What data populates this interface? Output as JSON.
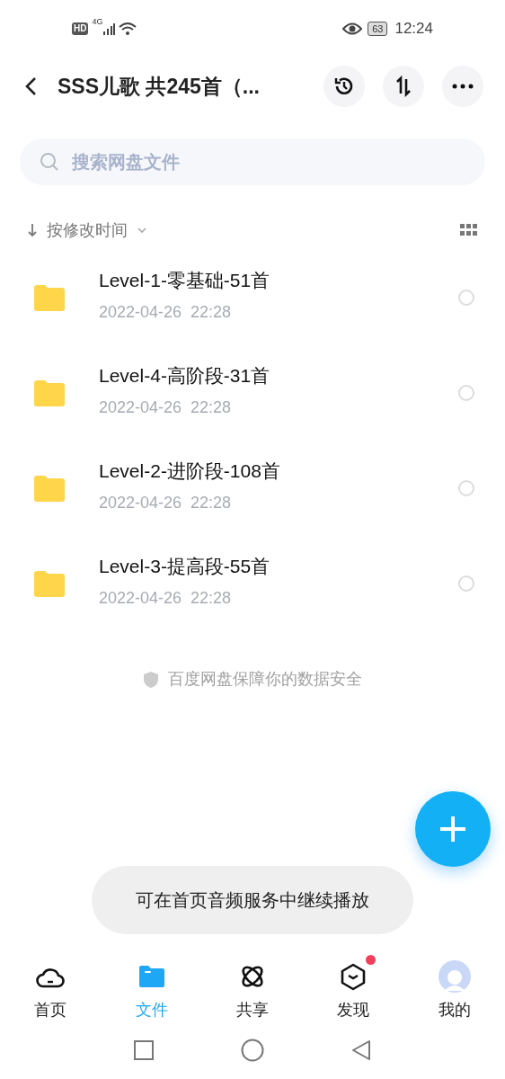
{
  "status_bar": {
    "hd": "HD",
    "network": "4G",
    "battery": "63",
    "time": "12:24"
  },
  "header": {
    "title": "SSS儿歌 共245首（..."
  },
  "search": {
    "placeholder": "搜索网盘文件"
  },
  "sort": {
    "label": "按修改时间"
  },
  "files": [
    {
      "name": "Level-1-零基础-51首",
      "date": "2022-04-26  22:28",
      "checked": false
    },
    {
      "name": "Level-4-高阶段-31首",
      "date": "2022-04-26  22:28",
      "checked": false
    },
    {
      "name": "Level-2-进阶段-108首",
      "date": "2022-04-26  22:28",
      "checked": false
    },
    {
      "name": "Level-3-提高段-55首",
      "date": "2022-04-26  22:28",
      "checked": false
    }
  ],
  "footer_note": "百度网盘保障你的数据安全",
  "toast": "可在首页音频服务中继续播放",
  "tabs": [
    {
      "kind": "cloud",
      "label": "首页",
      "selected": false,
      "dot": false
    },
    {
      "kind": "folder",
      "label": "文件",
      "selected": true,
      "dot": false
    },
    {
      "kind": "atom",
      "label": "共享",
      "selected": false,
      "dot": false
    },
    {
      "kind": "cube",
      "label": "发现",
      "selected": false,
      "dot": true
    },
    {
      "kind": "avatar",
      "label": "我的",
      "selected": false,
      "dot": false
    }
  ]
}
